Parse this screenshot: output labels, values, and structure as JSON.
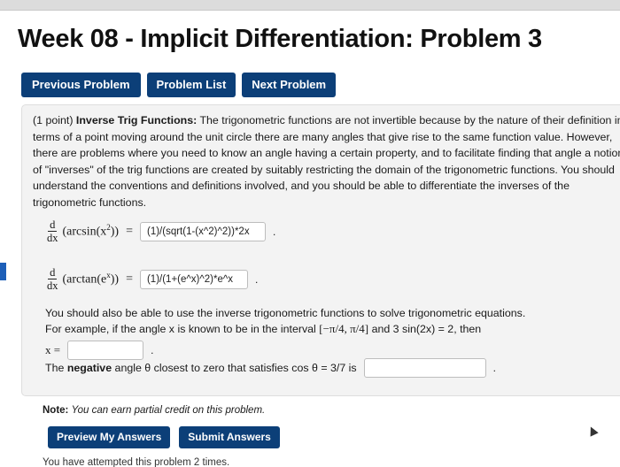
{
  "page": {
    "title": "Week 08 - Implicit Differentiation: Problem 3"
  },
  "nav": {
    "previous": "Previous Problem",
    "list": "Problem List",
    "next": "Next Problem"
  },
  "problem": {
    "points": "(1 point)",
    "topic": "Inverse Trig Functions:",
    "body": "The trigonometric functions are not invertible because by the nature of their definition in terms of a point moving around the unit circle there are many angles that give rise to the same function value. However, there are problems where you need to know an angle having a certain property, and to facilitate finding that angle a notion of \"inverses\" of the trig functions are created by suitably restricting the domain of the trigonometric functions. You should understand the conventions and definitions involved, and you should be able to differentiate the inverses of the trigonometric functions.",
    "eq1": {
      "d_num": "d",
      "d_den": "dx",
      "expr_pre": "(arcsin(x",
      "expr_sup": "2",
      "expr_post": "))",
      "equals": "=",
      "answer": "(1)/(sqrt(1-(x^2)^2))*2x",
      "dot": "."
    },
    "eq2": {
      "d_num": "d",
      "d_den": "dx",
      "expr_pre": "(arctan(e",
      "expr_sup": "x",
      "expr_post": "))",
      "equals": "=",
      "answer": "(1)/(1+(e^x)^2)*e^x",
      "dot": "."
    },
    "trig_text_1": "You should also be able to use the inverse trigonometric functions to solve trigonometric equations.",
    "trig_text_2": "For example, if the angle x is known to be in the interval",
    "interval": "[−π/4, π/4]",
    "trig_text_3": "and 3 sin(2x) = 2, then",
    "x_label": "x =",
    "x_answer": "",
    "x_dot": ".",
    "theta_text_pre": "The",
    "theta_bold": "negative",
    "theta_text_post": "angle θ closest to zero that satisfies cos θ = 3/7 is",
    "theta_answer": "",
    "theta_dot": "."
  },
  "note": {
    "label": "Note:",
    "text": "You can earn partial credit on this problem."
  },
  "actions": {
    "preview": "Preview My Answers",
    "submit": "Submit Answers"
  },
  "status": {
    "attempts": "You have attempted this problem 2 times."
  },
  "colors": {
    "button": "#0c3f78",
    "panel": "#f3f3f3"
  }
}
